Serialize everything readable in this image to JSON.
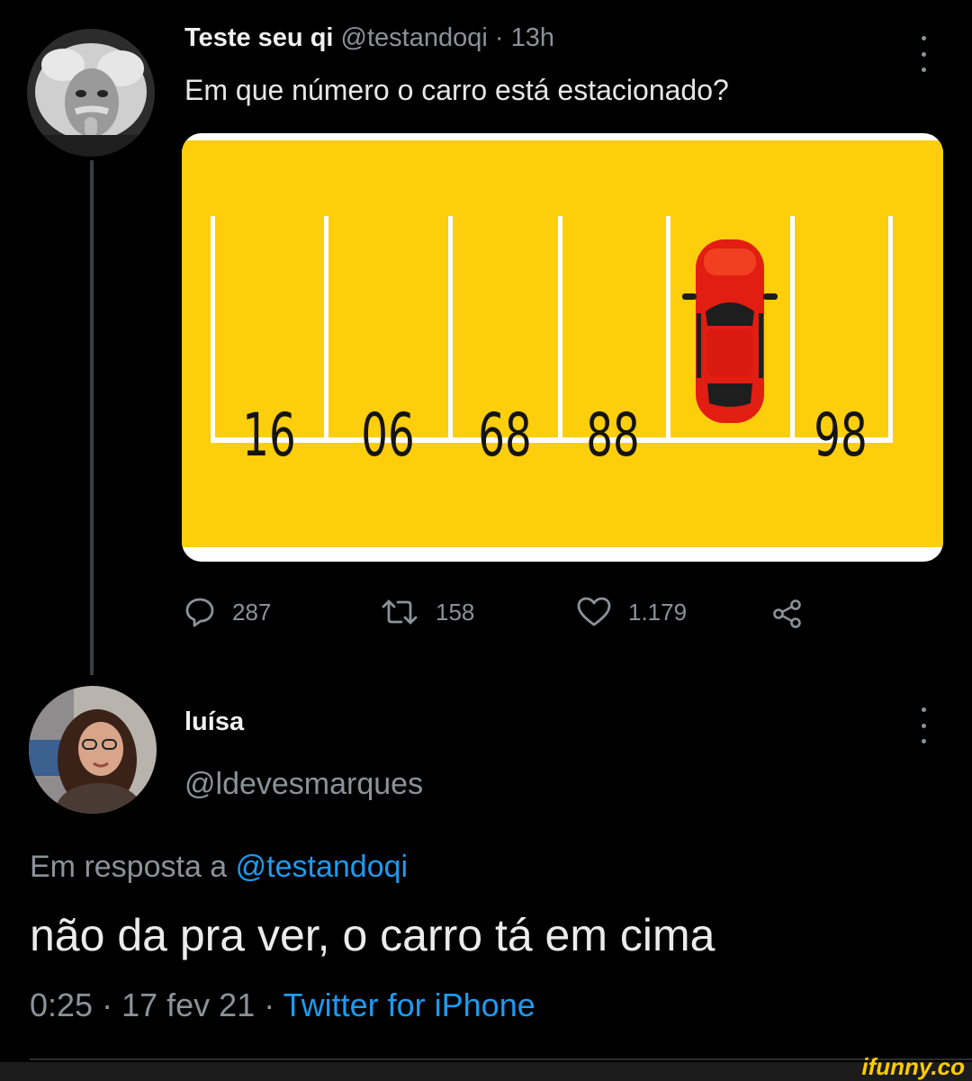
{
  "tweet": {
    "name": "Teste seu qi",
    "handle": "@testandoqi",
    "separator": "·",
    "time": "13h",
    "text": "Em que número o carro está estacionado?",
    "image": {
      "background_color": "#fcce0c",
      "line_color": "#ffffff",
      "car_color": "#e21d12",
      "spots": [
        "16",
        "06",
        "68",
        "88",
        "",
        "98"
      ],
      "car_spot_index": 4
    },
    "actions": {
      "replies": "287",
      "retweets": "158",
      "likes": "1.179"
    }
  },
  "reply": {
    "name": "luísa",
    "handle": "@ldevesmarques",
    "in_reply_to_prefix": "Em resposta a",
    "in_reply_to_handle": "@testandoqi",
    "text": "não da pra ver, o carro tá em cima",
    "time": "0:25",
    "date": "17 fev 21",
    "separator": "·",
    "source": "Twitter for iPhone"
  },
  "watermark": "ifunny.co",
  "colors": {
    "background": "#000000",
    "link": "#1d9bf0",
    "muted": "#8b9299"
  }
}
